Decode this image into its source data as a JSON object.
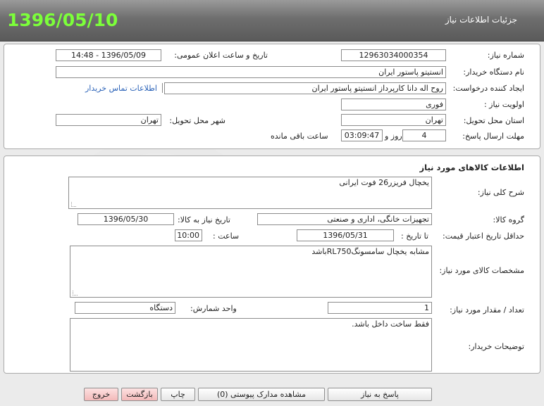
{
  "header": {
    "date": "1396/05/10",
    "title": "جزئیات اطلاعات نیاز"
  },
  "need": {
    "need_number_label": "شماره نیاز:",
    "need_number": "12963034000354",
    "announce_label": "تاریخ و ساعت اعلان عمومی:",
    "announce_value": "1396/05/09 - 14:48",
    "buyer_org_label": "نام دستگاه خریدار:",
    "buyer_org": "انستیتو پاستور ایران",
    "requester_label": "ایجاد کننده درخواست:",
    "requester": "روح اله دانا کارپرداز انستیتو پاستور ایران",
    "contact_link": "اطلاعات تماس خریدار",
    "priority_label": "اولویت نیاز :",
    "priority": "فوری",
    "province_label": "استان محل تحویل:",
    "province": "تهران",
    "city_label": "شهر محل تحویل:",
    "city": "تهران",
    "deadline_label": "مهلت ارسال پاسخ:",
    "days": "4",
    "days_suffix": "روز و",
    "time_left": "03:09:47",
    "time_suffix": "ساعت باقی مانده"
  },
  "goods": {
    "section_title": "اطلاعات کالاهای مورد نیاز",
    "summary_label": "شرح کلی نیاز:",
    "summary": "یخچال فریزر26 فوت ایرانی",
    "group_label": "گروه کالا:",
    "group": "تجهیزات خانگی، اداری و صنعتی",
    "need_date_label": "تاریخ نیاز به کالا:",
    "need_date": "1396/05/30",
    "min_validity_label": "حداقل تاریخ اعتبار قیمت:",
    "until_date_label": "تا تاریخ :",
    "until_date": "1396/05/31",
    "time_label": "ساعت :",
    "time": "10:00",
    "specs_label": "مشخصات کالای مورد نیاز:",
    "specs": "مشابه یخچال سامسونگRL750باشد",
    "qty_label": "تعداد / مقدار مورد نیاز:",
    "qty": "1",
    "unit_label": "واحد شمارش:",
    "unit": "دستگاه",
    "buyer_notes_label": "توضیحات خریدار:",
    "buyer_notes": "فقط ساخت داخل باشد."
  },
  "buttons": {
    "reply": "پاسخ به نیاز",
    "attachments": "مشاهده مدارک پیوستی (0)",
    "print": "چاپ",
    "back": "بازگشت",
    "exit": "خروج"
  },
  "colors": {
    "date_green": "#7cff3a",
    "header_gray": "#6e6e6e",
    "link_blue": "#2a62b8",
    "exit_pink": "#f3b9b9"
  }
}
